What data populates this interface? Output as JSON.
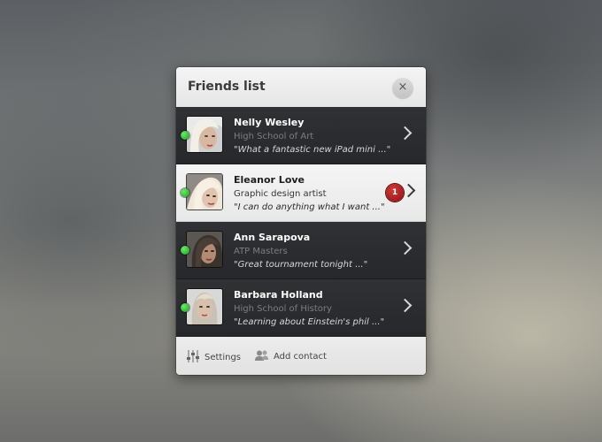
{
  "panel": {
    "title": "Friends list",
    "close_label": "×"
  },
  "friends": [
    {
      "name": "Nelly Wesley",
      "subtitle": "High School of Art",
      "message": "\"What a fantastic new iPad mini ...\"",
      "online": true,
      "badge": ""
    },
    {
      "name": "Eleanor Love",
      "subtitle": "Graphic design artist",
      "message": "\"I can do anything what I want ...\"",
      "online": true,
      "badge": "1"
    },
    {
      "name": "Ann Sarapova",
      "subtitle": "ATP Masters",
      "message": "\"Great tournament tonight ...\"",
      "online": true,
      "badge": ""
    },
    {
      "name": "Barbara Holland",
      "subtitle": "High School of History",
      "message": "\"Learning about Einstein's phil ...\"",
      "online": true,
      "badge": ""
    }
  ],
  "footer": {
    "settings_label": "Settings",
    "add_contact_label": "Add contact"
  },
  "colors": {
    "online": "#2eb82e",
    "badge": "#b51d1d",
    "row_dark": "#2b2d30",
    "row_active": "#eeeeee"
  },
  "icons": {
    "close": "close-icon",
    "chevron": "chevron-right-icon",
    "settings": "sliders-icon",
    "add_contact": "add-user-icon"
  }
}
